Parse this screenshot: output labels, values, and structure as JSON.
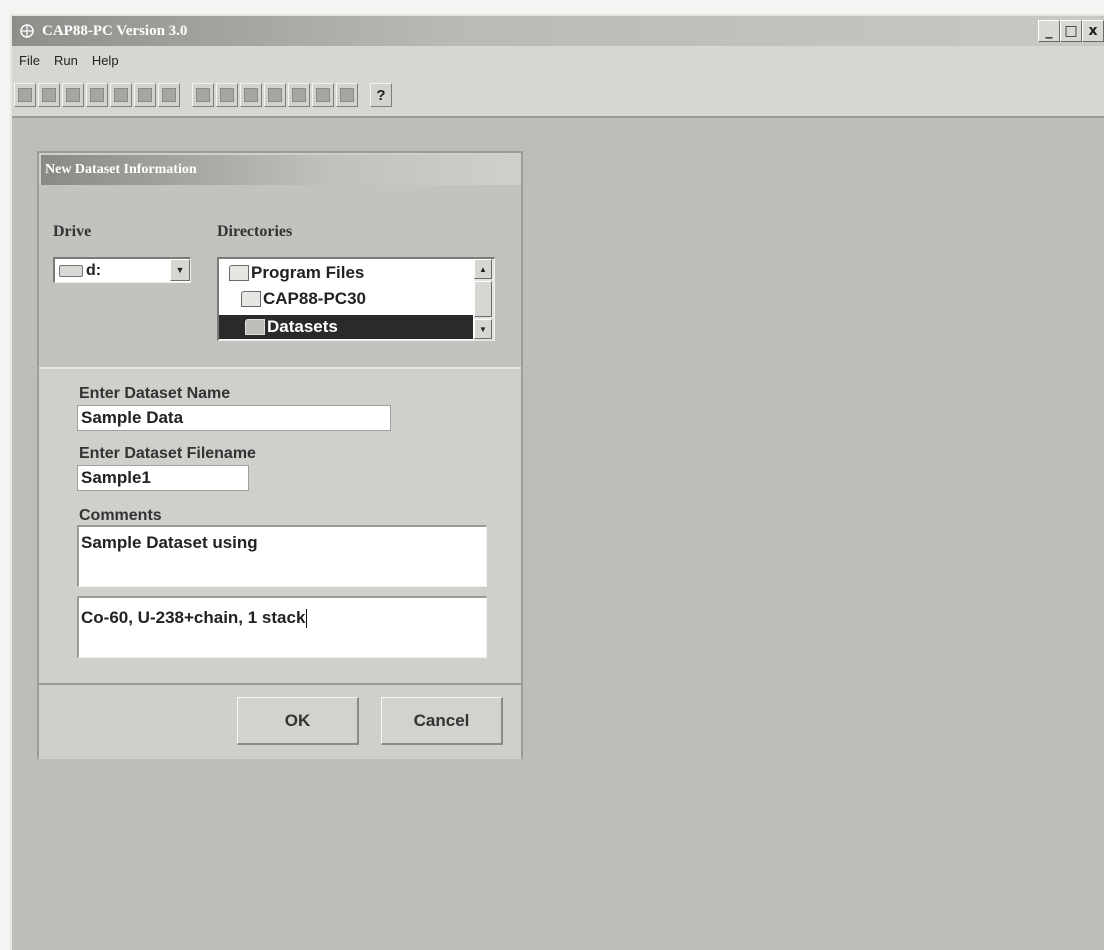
{
  "window": {
    "title": "CAP88-PC Version 3.0",
    "controls": {
      "minimize": "_",
      "maximize": "□",
      "close": "x"
    }
  },
  "menu": {
    "items": [
      {
        "label": "File"
      },
      {
        "label": "Run"
      },
      {
        "label": "Help"
      }
    ]
  },
  "toolbar": {
    "help_label": "?"
  },
  "dialog": {
    "title": "New Dataset Information",
    "drive_label": "Drive",
    "drive_value": "d:",
    "directories_label": "Directories",
    "directories": [
      {
        "label": "Program Files"
      },
      {
        "label": "CAP88-PC30"
      },
      {
        "label": "Datasets",
        "selected": true
      }
    ],
    "dataset_name_label": "Enter Dataset Name",
    "dataset_name_value": "Sample Data",
    "dataset_filename_label": "Enter Dataset Filename",
    "dataset_filename_value": "Sample1",
    "comments_label": "Comments",
    "comment_line_1": "Sample Dataset using",
    "comment_line_2": "Co-60, U-238+chain, 1 stack",
    "ok_label": "OK",
    "cancel_label": "Cancel"
  }
}
